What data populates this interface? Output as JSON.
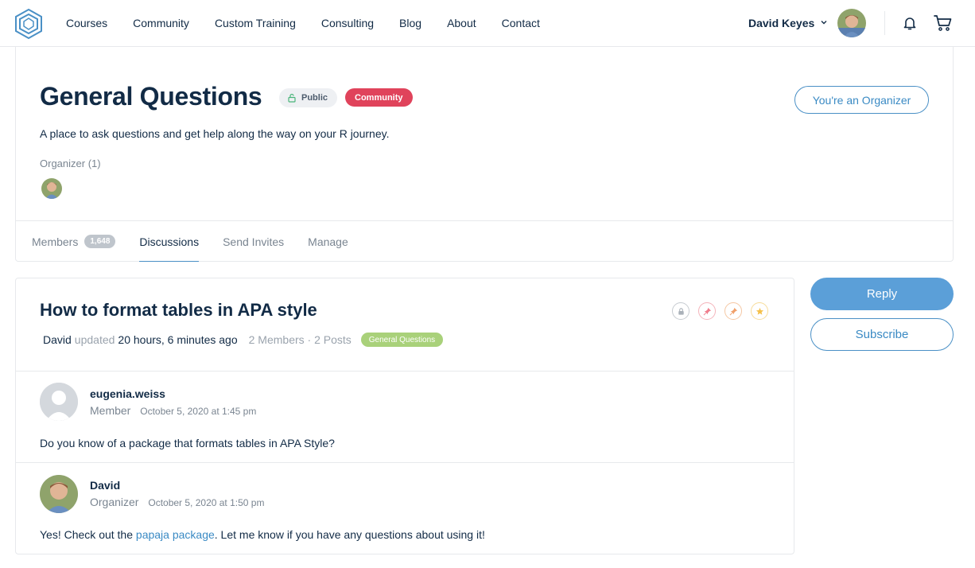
{
  "header": {
    "nav": [
      "Courses",
      "Community",
      "Custom Training",
      "Consulting",
      "Blog",
      "About",
      "Contact"
    ],
    "user_name": "David Keyes"
  },
  "group": {
    "title": "General Questions",
    "badge_public": "Public",
    "badge_community": "Community",
    "organizer_button": "You're an Organizer",
    "description": "A place to ask questions and get help along the way on your R journey.",
    "organizer_label": "Organizer (1)",
    "tabs": [
      {
        "label": "Members",
        "count": "1,648"
      },
      {
        "label": "Discussions"
      },
      {
        "label": "Send Invites"
      },
      {
        "label": "Manage"
      }
    ],
    "active_tab": "Discussions"
  },
  "discussion": {
    "title": "How to format tables in APA style",
    "author": "David",
    "updated_label": "updated",
    "updated_time": "20 hours, 6 minutes ago",
    "counts": "2 Members · 2 Posts",
    "forum_tag": "General Questions",
    "posts": [
      {
        "author": "eugenia.weiss",
        "role": "Member",
        "date": "October 5, 2020 at 1:45 pm",
        "body": "Do you know of a package that formats tables in APA Style?"
      },
      {
        "author": "David",
        "role": "Organizer",
        "date": "October 5, 2020 at 1:50 pm",
        "body_before": "Yes! Check out the ",
        "body_link": "papaja package",
        "body_after": ". Let me know if you have any questions about using it!"
      }
    ]
  },
  "sidebar": {
    "reply_label": "Reply",
    "subscribe_label": "Subscribe"
  },
  "colors": {
    "accent": "#5b9fd8",
    "community_badge": "#e0435b",
    "forum_tag": "#a9d17a",
    "text": "#122b46"
  }
}
